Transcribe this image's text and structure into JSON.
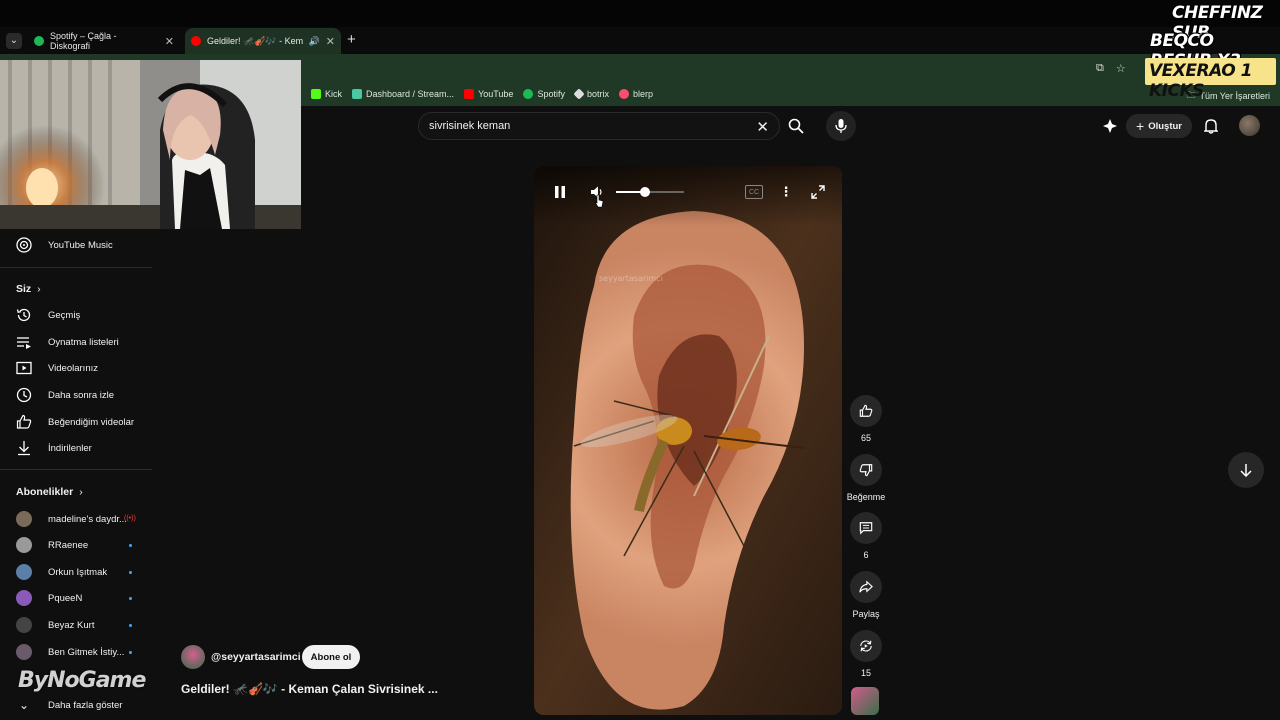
{
  "overlay": {
    "line1": "CHEFFINZ SUB",
    "line2": "BEQCO RESUB X3",
    "line3": "VEXERAO 1 KICKS"
  },
  "browser": {
    "tabs": [
      {
        "label": "Spotify – Çağla - Diskografi",
        "favicon_color": "#1db954"
      },
      {
        "label": "Geldiler! 🦟🎻🎶 - Kemar",
        "favicon_color": "#ff0000"
      }
    ],
    "bookmarks": [
      {
        "label": "Kick",
        "color": "#53fc18"
      },
      {
        "label": "Dashboard / Stream...",
        "color": "#4cc7a3"
      },
      {
        "label": "YouTube",
        "color": "#ff0000"
      },
      {
        "label": "Spotify",
        "color": "#1db954"
      },
      {
        "label": "botrix",
        "color": "#dddddd"
      },
      {
        "label": "blerp",
        "color": "#ff4d6d"
      }
    ],
    "all_bookmarks_label": "Tüm Yer İşaretleri"
  },
  "header": {
    "search_query": "sivrisinek keman",
    "create_label": "Oluştur"
  },
  "sidebar": {
    "youtube_music": "YouTube Music",
    "you_section": "Siz",
    "you_items": [
      {
        "label": "Geçmiş",
        "icon": "history-icon"
      },
      {
        "label": "Oynatma listeleri",
        "icon": "playlist-icon"
      },
      {
        "label": "Videolarınız",
        "icon": "your-videos-icon"
      },
      {
        "label": "Daha sonra izle",
        "icon": "watch-later-icon"
      },
      {
        "label": "Beğendiğim videolar",
        "icon": "liked-icon"
      },
      {
        "label": "İndirilenler",
        "icon": "download-icon"
      }
    ],
    "subs_section": "Abonelikler",
    "subscriptions": [
      {
        "label": "madeline's daydr...",
        "color": "#7a6a5a",
        "live": true
      },
      {
        "label": "RRaenee",
        "color": "#9a9a9a",
        "live": false
      },
      {
        "label": "Orkun Işıtmak",
        "color": "#5a7fa8",
        "live": false
      },
      {
        "label": "PqueeN",
        "color": "#8a5ab8",
        "live": false
      },
      {
        "label": "Beyaz Kurt",
        "color": "#444444",
        "live": false
      },
      {
        "label": "Ben Gitmek İstiy...",
        "color": "#6a5a6a",
        "live": false
      }
    ],
    "show_more": "Daha fazla göster"
  },
  "watermark": "ByNoGame",
  "short": {
    "watermark": "seyyartasarımcı",
    "volume_fraction": 0.42,
    "actions": {
      "likes": "65",
      "dislike_label": "Beğenme",
      "comments": "6",
      "share_label": "Paylaş",
      "remix": "15"
    },
    "channel": "@seyyartasarimci",
    "subscribe_label": "Abone ol",
    "title": "Geldiler! 🦟🎻🎶 - Keman Çalan Sivrisinek ..."
  }
}
